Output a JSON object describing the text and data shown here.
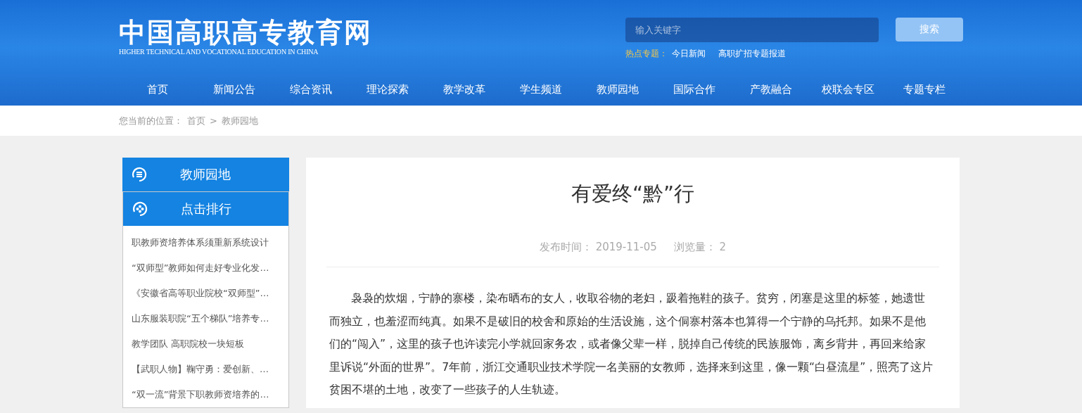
{
  "header": {
    "logo_title": "中国高职高专教育网",
    "logo_subtitle": "HIGHER TECHNICAL AND VOCATIONAL EDUCATION IN CHINA",
    "search": {
      "placeholder": "输入关键字",
      "button": "搜索"
    },
    "hot_topics": {
      "label": "热点专题：",
      "links": [
        "今日新闻",
        "高职扩招专题报道"
      ]
    }
  },
  "nav": [
    "首页",
    "新闻公告",
    "综合资讯",
    "理论探索",
    "教学改革",
    "学生频道",
    "教师园地",
    "国际合作",
    "产教融合",
    "校联会专区",
    "专题专栏"
  ],
  "breadcrumb": {
    "label": "您当前的位置：",
    "links": [
      "首页",
      "教师园地"
    ],
    "separator": ">"
  },
  "sidebar": {
    "sections": [
      {
        "kind": "menu",
        "title": "教师园地"
      },
      {
        "kind": "ranking",
        "title": "点击排行"
      }
    ],
    "items": [
      "职教师资培养体系须重新系统设计",
      "“双师型”教师如何走好专业化发…",
      "《安徽省高等职业院校“双师型”…",
      "山东服装职院“五个梯队”培养专…",
      "教学团队 高职院校一块短板",
      "【武职人物】鞠守勇：爱创新、…",
      "“双一流”背景下职教师资培养的…"
    ]
  },
  "article": {
    "title": "有爱终“黔”行",
    "meta": [
      {
        "label": "发布时间：",
        "value": "2019-11-05"
      },
      {
        "label": "浏览量：",
        "value": "2"
      }
    ],
    "paragraph": "袅袅的炊烟，宁静的寨楼，染布晒布的女人，收取谷物的老妇，趿着拖鞋的孩子。贫穷，闭塞是这里的标签，她遗世而独立，也羞涩而纯真。如果不是破旧的校舍和原始的生活设施，这个侗寨村落本也算得一个宁静的乌托邦。如果不是他们的“闯入”，这里的孩子也许读完小学就回家务农，或者像父辈一样，脱掉自己传统的民族服饰，离乡背井，再回来给家里诉说“外面的世界”。7年前，浙江交通职业技术学院一名美丽的女教师，选择来到这里，像一颗“白昼流星”，照亮了这片贫困不堪的土地，改变了一些孩子的人生轨迹。"
  }
}
